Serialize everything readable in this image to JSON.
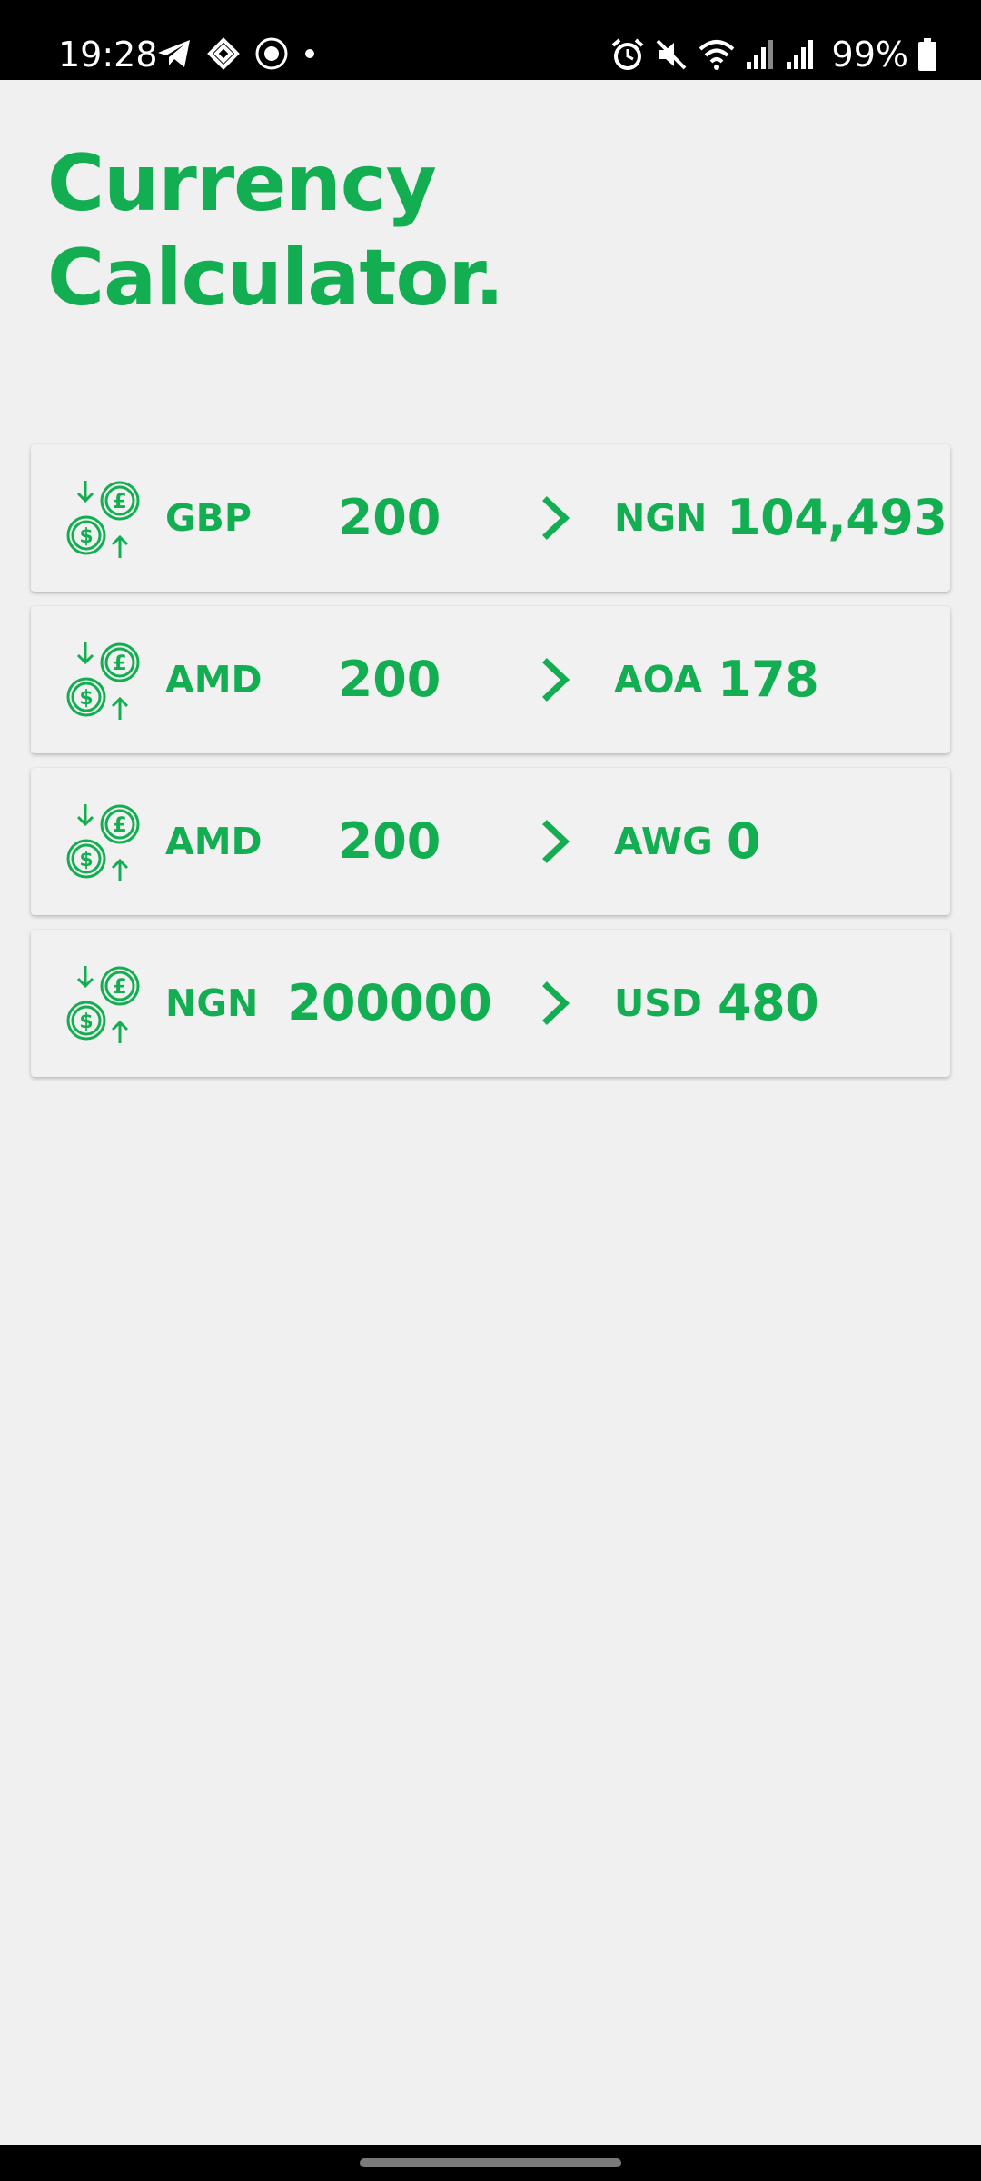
{
  "status_bar": {
    "time": "19:28",
    "battery": "99%",
    "left_icons": [
      "telegram-icon",
      "app-icon",
      "crest-icon",
      "dot-icon"
    ],
    "right_icons": [
      "alarm-icon",
      "mute-icon",
      "wifi-icon",
      "signal-icon",
      "signal-icon",
      "battery-icon"
    ]
  },
  "title": {
    "line1": "Currency",
    "line2": "Calculator."
  },
  "accent_color": "#14ae52",
  "conversions": [
    {
      "from_code": "GBP",
      "from_amount": "200",
      "to_code": "NGN",
      "to_amount": "104,493"
    },
    {
      "from_code": "AMD",
      "from_amount": "200",
      "to_code": "AOA",
      "to_amount": "178"
    },
    {
      "from_code": "AMD",
      "from_amount": "200",
      "to_code": "AWG",
      "to_amount": "0"
    },
    {
      "from_code": "NGN",
      "from_amount": "200000",
      "to_code": "USD",
      "to_amount": "480"
    }
  ]
}
